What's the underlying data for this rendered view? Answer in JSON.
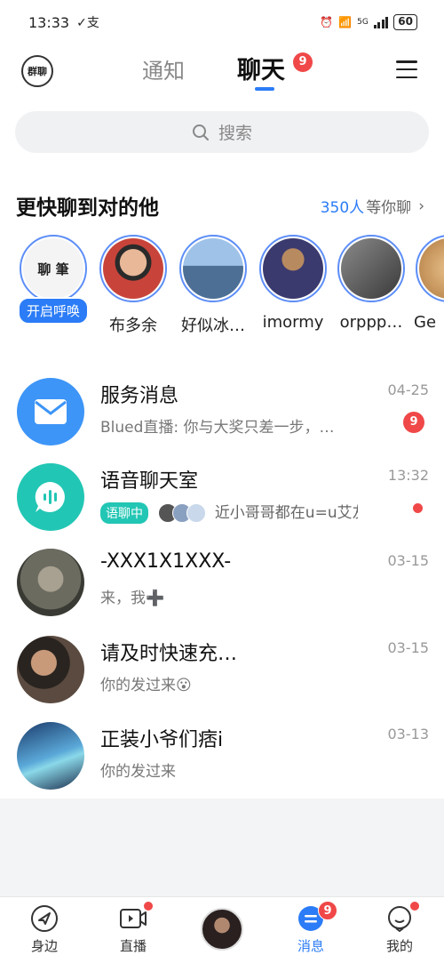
{
  "status_bar": {
    "time": "13:33",
    "network": "5G",
    "battery": "60"
  },
  "header": {
    "group_label": "群聊",
    "tab_notify": "通知",
    "tab_chat": "聊天",
    "chat_badge": "9"
  },
  "search": {
    "placeholder": "搜索"
  },
  "quick": {
    "title": "更快聊到对的他",
    "count": "350人",
    "count_suffix": "等你聊",
    "users": [
      {
        "name": "开启呼唤",
        "is_call": true,
        "color": "#f4f4f4"
      },
      {
        "name": "布多余",
        "color": "#c8443a"
      },
      {
        "name": "好似冰…",
        "color": "#6a8fb8"
      },
      {
        "name": "imormy",
        "color": "#8a6c50"
      },
      {
        "name": "orppp…",
        "color": "#5b5b5b"
      },
      {
        "name": "Ge",
        "color": "#d8a56a"
      }
    ]
  },
  "conversations": [
    {
      "title": "服务消息",
      "preview": "Blued直播: 你与大奖只差一步，…",
      "time": "04-25",
      "badge": "9",
      "type": "service"
    },
    {
      "title": "语音聊天室",
      "voice_tag": "语聊中",
      "preview": "近小哥哥都在u=u艾友r",
      "time": "13:32",
      "dot": true,
      "type": "voice"
    },
    {
      "title": "-XXX1X1XXX-",
      "preview": "来，我➕",
      "time": "03-15",
      "type": "photo",
      "color": "#6b6b60"
    },
    {
      "title": "请及时快速充…",
      "preview": "你的发过来😮",
      "time": "03-15",
      "type": "photo",
      "color": "#4a3a30"
    },
    {
      "title": "正装小爷们痞i",
      "preview": "你的发过来",
      "time": "03-13",
      "type": "photo",
      "color": "#2d5a8a"
    }
  ],
  "bottom_nav": {
    "nearby": "身边",
    "live": "直播",
    "messages": "消息",
    "messages_badge": "9",
    "mine": "我的"
  },
  "colors": {
    "accent": "#2b7cf6",
    "badge": "#f04848",
    "voice": "#22c6b4"
  }
}
